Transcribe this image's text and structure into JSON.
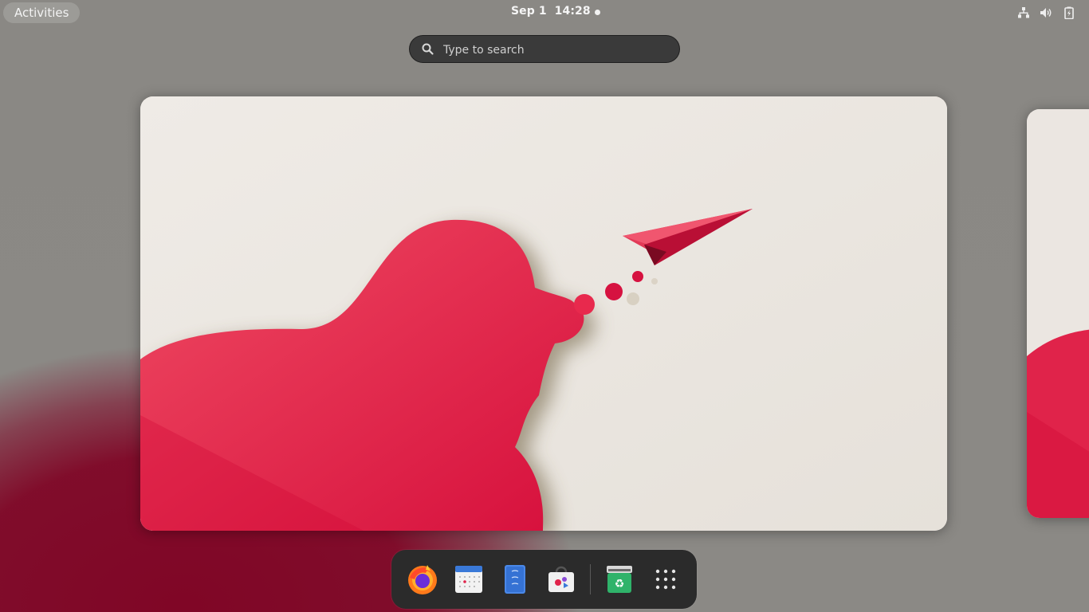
{
  "topbar": {
    "activities_label": "Activities",
    "date": "Sep 1",
    "time": "14:28",
    "tray_icons": [
      "network-wired-icon",
      "speaker-volume-icon",
      "battery-charging-icon"
    ]
  },
  "search": {
    "placeholder": "Type to search",
    "value": ""
  },
  "workspaces": [
    {
      "label": "workspace-1",
      "wallpaper": "pink-cloud-paper-plane"
    },
    {
      "label": "workspace-2",
      "wallpaper": "pink-cloud-paper-plane"
    }
  ],
  "dock": {
    "apps": [
      {
        "icon": "firefox-icon"
      },
      {
        "icon": "calendar-icon"
      },
      {
        "icon": "text-editor-icon"
      },
      {
        "icon": "software-store-icon"
      },
      {
        "icon": "trash-icon"
      }
    ],
    "show_apps_icon": "app-grid-icon"
  },
  "colors": {
    "accent_red": "#e0234a",
    "wallpaper_bg": "#ebe6e0",
    "panel_dark": "#2b2b2b"
  }
}
